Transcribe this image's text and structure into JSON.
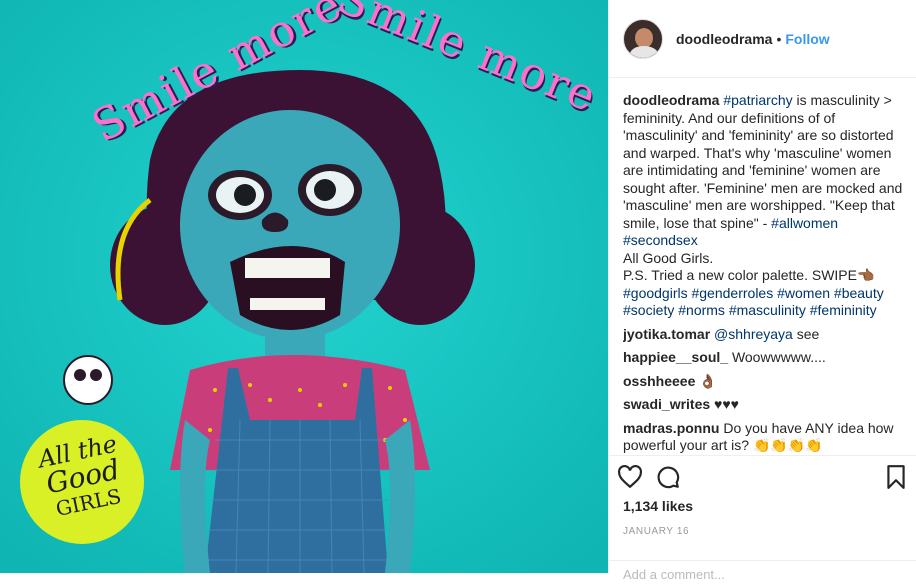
{
  "post": {
    "username": "doodleodrama",
    "dot": "•",
    "follow_label": "Follow"
  },
  "artwork": {
    "text_arc_left": "Smile more",
    "text_arc_right": "Smile more",
    "badge_line1": "All the",
    "badge_line2": "Good",
    "badge_line3": "GIRLS"
  },
  "caption": {
    "username": "doodleodrama",
    "tag1": "#patriarchy",
    "text1": " is masculinity > femininity. And our definitions of of 'masculinity' and 'femininity' are so distorted and warped. That's why 'masculine' women are intimidating and 'feminine' women are sought after. 'Feminine' men are mocked and 'masculine' men are worshipped. \"Keep that smile, lose that spine\" - ",
    "tag2": "#allwomen",
    "tag3": "#secondsex",
    "text2": "All Good Girls.",
    "text3": "P.S. Tried a new color palette. SWIPE👈🏾",
    "tags_line1": "#goodgirls #genderroles #women #beauty",
    "tags_line2": "#society #norms #masculinity #femininity"
  },
  "comments": [
    {
      "user": "jyotika.tomar",
      "mention": "@shhreyaya",
      "text": " see"
    },
    {
      "user": "happiee__soul_",
      "mention": "",
      "text": "Woowwwww...."
    },
    {
      "user": "osshheeee",
      "mention": "",
      "text": "👌🏾"
    },
    {
      "user": "swadi_writes",
      "mention": "",
      "text": "♥♥♥"
    },
    {
      "user": "madras.ponnu",
      "mention": "",
      "text": "Do you have ANY idea how powerful your art is? 👏👏👏👏"
    }
  ],
  "actions": {
    "like_icon": "heart-icon",
    "comment_icon": "comment-icon",
    "save_icon": "bookmark-icon",
    "likes": "1,134 likes",
    "date": "JANUARY 16",
    "add_comment_placeholder": "Add a comment..."
  },
  "colors": {
    "background_teal": "#19c9c6",
    "link_blue": "#3897f0",
    "hashtag_blue": "#003569"
  }
}
